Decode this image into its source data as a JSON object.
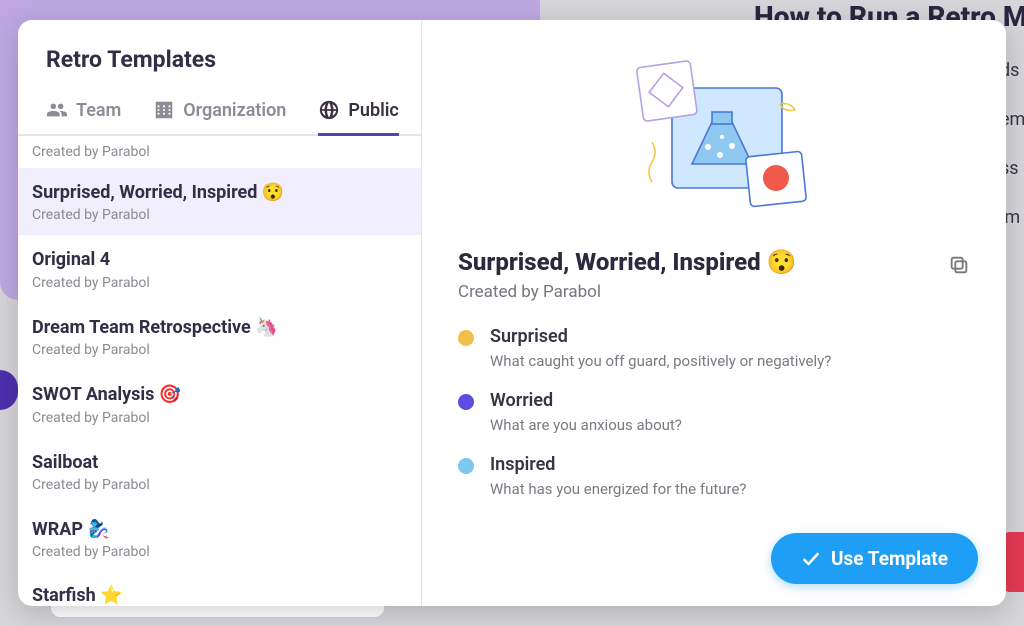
{
  "background": {
    "heading": "How to Run a Retro Me",
    "snips": [
      "ds",
      "em",
      "ss",
      "im"
    ]
  },
  "modal": {
    "title": "Retro Templates",
    "tabs": [
      {
        "key": "team",
        "label": "Team"
      },
      {
        "key": "org",
        "label": "Organization"
      },
      {
        "key": "public",
        "label": "Public"
      }
    ],
    "active_tab": "public",
    "residual_creator": "Created by Parabol",
    "templates": [
      {
        "name": "Surprised, Worried, Inspired 😯",
        "creator": "Created by Parabol",
        "selected": true
      },
      {
        "name": "Original 4",
        "creator": "Created by Parabol",
        "selected": false
      },
      {
        "name": "Dream Team Retrospective 🦄",
        "creator": "Created by Parabol",
        "selected": false
      },
      {
        "name": "SWOT Analysis 🎯",
        "creator": "Created by Parabol",
        "selected": false
      },
      {
        "name": "Sailboat",
        "creator": "Created by Parabol",
        "selected": false
      },
      {
        "name": "WRAP 🧞‍♀️",
        "creator": "Created by Parabol",
        "selected": false
      }
    ],
    "cutoff_template": "Starfish ⭐",
    "use_label": "Use Template"
  },
  "detail": {
    "title": "Surprised, Worried, Inspired 😯",
    "creator": "Created by Parabol",
    "prompts": [
      {
        "name": "Surprised",
        "question": "What caught you off guard, positively or negatively?",
        "color": "#f2c04a"
      },
      {
        "name": "Worried",
        "question": "What are you anxious about?",
        "color": "#5b4ee0"
      },
      {
        "name": "Inspired",
        "question": "What has you energized for the future?",
        "color": "#7cc8ef"
      }
    ]
  }
}
